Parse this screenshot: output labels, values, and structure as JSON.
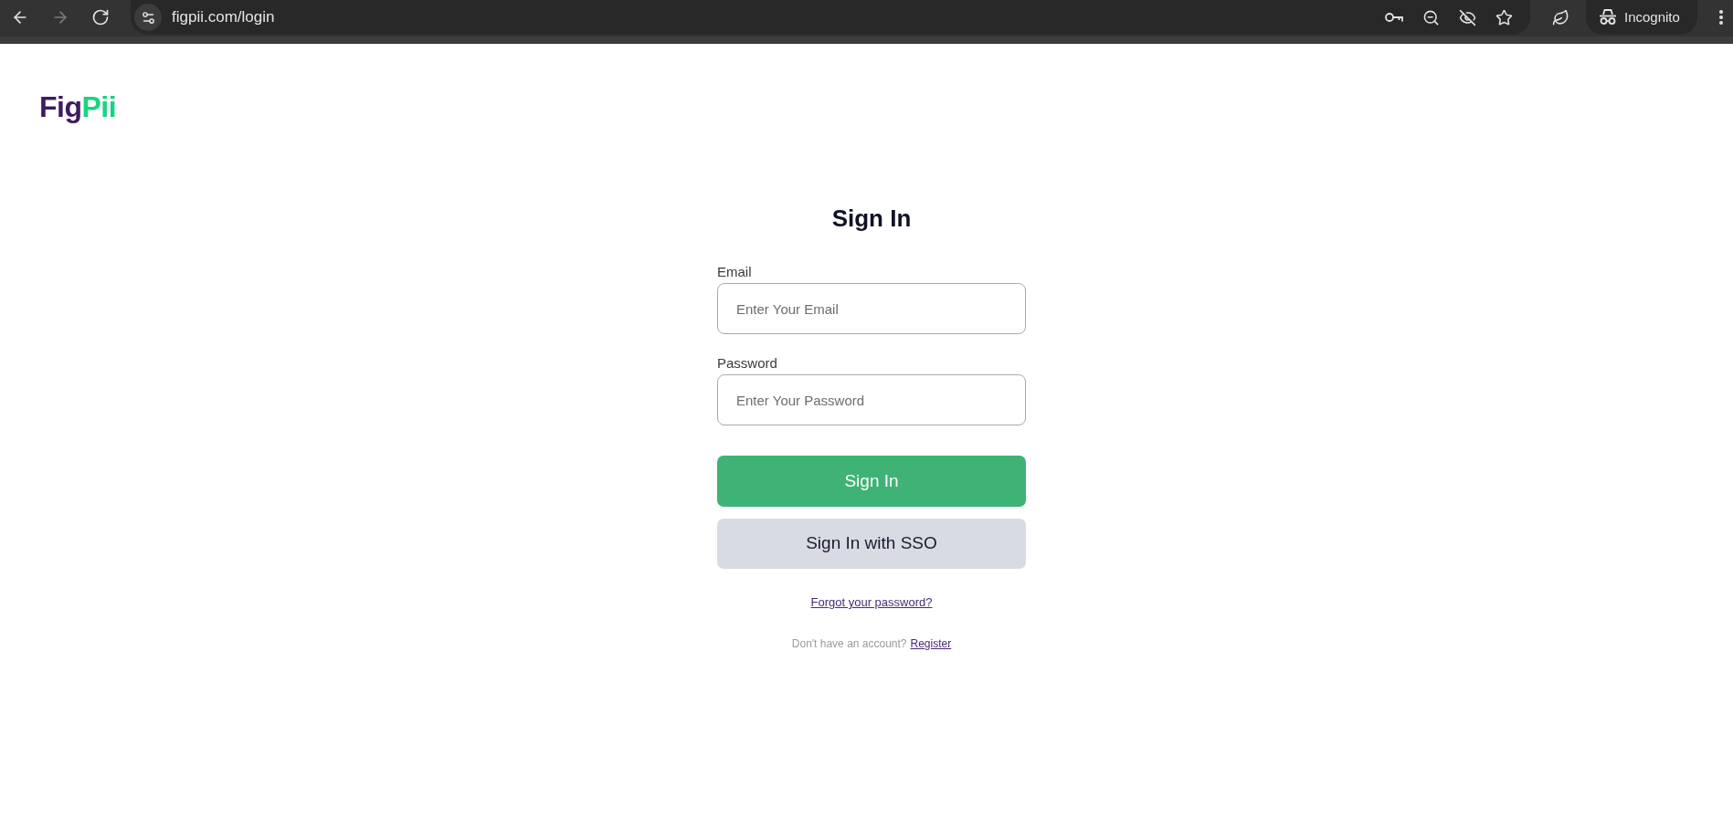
{
  "browser": {
    "nav_buttons": [
      {
        "kind": "back",
        "disabled": false
      },
      {
        "kind": "forward",
        "disabled": true
      },
      {
        "kind": "reload",
        "disabled": false
      }
    ],
    "url": "figpii.com/login",
    "profile": "Incognito"
  },
  "logo": {
    "parts": [
      "Fig",
      "Pii"
    ]
  },
  "form": {
    "title": "Sign In",
    "fields": [
      {
        "label": "Email",
        "placeholder": "Enter Your Email"
      },
      {
        "label": "Password",
        "placeholder": "Enter Your Password"
      }
    ],
    "buttons": [
      {
        "kind": "primary",
        "label": "Sign In"
      },
      {
        "kind": "secondary",
        "label": "Sign In with SSO"
      }
    ],
    "forgot_link": "Forgot your password?",
    "register": {
      "prompt": "Don't have an account?",
      "link": "Register"
    }
  }
}
